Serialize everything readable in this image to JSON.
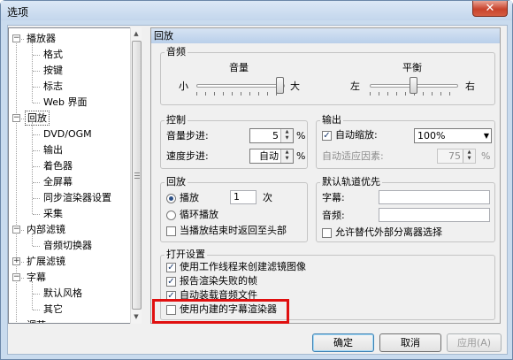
{
  "window": {
    "title": "选项",
    "close_glyph": "✕"
  },
  "tree": {
    "items": [
      {
        "label": "播放器",
        "level": 0,
        "expander": "−"
      },
      {
        "label": "格式",
        "level": 1
      },
      {
        "label": "按键",
        "level": 1
      },
      {
        "label": "标志",
        "level": 1
      },
      {
        "label": "Web 界面",
        "level": 1
      },
      {
        "label": "回放",
        "level": 0,
        "expander": "−",
        "selected": true
      },
      {
        "label": "DVD/OGM",
        "level": 1
      },
      {
        "label": "输出",
        "level": 1
      },
      {
        "label": "着色器",
        "level": 1
      },
      {
        "label": "全屏幕",
        "level": 1
      },
      {
        "label": "同步渲染器设置",
        "level": 1
      },
      {
        "label": "采集",
        "level": 1
      },
      {
        "label": "内部滤镜",
        "level": 0,
        "expander": "−"
      },
      {
        "label": "音频切换器",
        "level": 1
      },
      {
        "label": "扩展滤镜",
        "level": 0,
        "expander": "+"
      },
      {
        "label": "字幕",
        "level": 0,
        "expander": "−"
      },
      {
        "label": "默认风格",
        "level": 1
      },
      {
        "label": "其它",
        "level": 1
      },
      {
        "label": "调节",
        "level": 0
      }
    ]
  },
  "scrollbar": {
    "up": "▲",
    "down": "▼"
  },
  "panel": {
    "title": "回放"
  },
  "audio": {
    "title": "音频",
    "volume_label": "音量",
    "volume_min": "小",
    "volume_max": "大",
    "volume_level": 0.95,
    "balance_label": "平衡",
    "balance_left": "左",
    "balance_right": "右",
    "balance_level": 0.5
  },
  "control": {
    "title": "控制",
    "volume_step_label": "音量步进:",
    "volume_step_value": "5",
    "volume_step_unit": "%",
    "speed_step_label": "速度步进:",
    "speed_step_value": "自动",
    "speed_step_unit": "%"
  },
  "output": {
    "title": "输出",
    "autozoom_label": "自动缩放:",
    "autozoom_checked": true,
    "autozoom_value": "100%",
    "autofit_label": "自动适应因素:",
    "autofit_value": "75",
    "autofit_unit": "%"
  },
  "playback": {
    "title": "回放",
    "play_label": "播放",
    "play_count": "1",
    "play_unit": "次",
    "loop_label": "循环播放",
    "rewind_label": "当播放结束时返回至头部"
  },
  "default_track": {
    "title": "默认轨道优先",
    "subtitle_label": "字幕:",
    "subtitle_value": "",
    "audio_label": "音频:",
    "audio_value": "",
    "external_splitter_label": "允许替代外部分离器选择"
  },
  "open_settings": {
    "title": "打开设置",
    "worker_thread_label": "使用工作线程来创建滤镜图像",
    "worker_thread_checked": true,
    "report_fail_label": "报告渲染失败的帧",
    "report_fail_checked": true,
    "auto_load_audio_label": "自动装载音频文件",
    "auto_load_audio_checked": true,
    "internal_sub_label": "使用内建的字幕渲染器",
    "internal_sub_checked": false
  },
  "buttons": {
    "ok": "确定",
    "cancel": "取消",
    "apply": "应用(A)"
  },
  "icons": {
    "spin_up": "▲",
    "spin_down": "▼",
    "combo_arrow": "▼",
    "check": "✓"
  },
  "colors": {
    "highlight_box": "#e01010",
    "selection": "#3399ff"
  }
}
